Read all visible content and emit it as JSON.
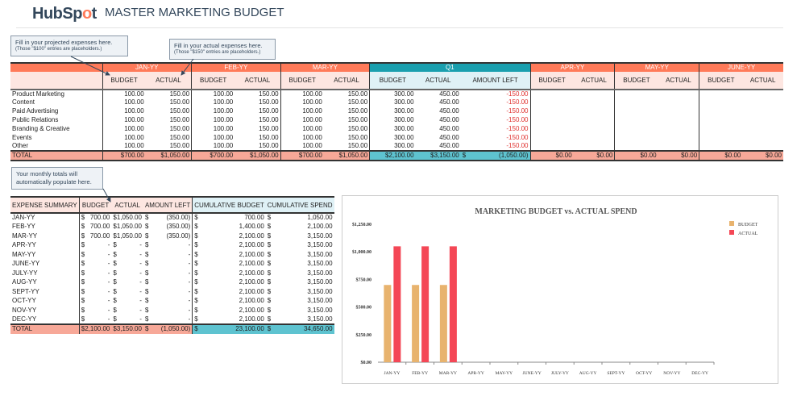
{
  "header": {
    "logo": "HubSpot",
    "title": "MASTER MARKETING BUDGET"
  },
  "callouts": {
    "projected": {
      "main": "Fill in your projected expenses here.",
      "note": "(Those \"$100\" entries are placeholders.)"
    },
    "actual": {
      "main": "Fill in your actual expenses here.",
      "note": "(Those \"$150\" entries are placeholders.)"
    },
    "monthly": {
      "main": "Your monthly totals will automatically populate here."
    }
  },
  "top_table": {
    "months": [
      "JAN-YY",
      "FEB-YY",
      "MAR-YY"
    ],
    "quarter": "Q1",
    "later_months": [
      "APR-YY",
      "MAY-YY",
      "JUNE-YY"
    ],
    "sub": {
      "budget": "BUDGET",
      "actual": "ACTUAL",
      "left": "AMOUNT LEFT"
    },
    "rows": [
      {
        "label": "Product Marketing",
        "budget": "100.00",
        "actual": "150.00",
        "q_budget": "300.00",
        "q_actual": "450.00",
        "q_left": "-150.00"
      },
      {
        "label": "Content",
        "budget": "100.00",
        "actual": "150.00",
        "q_budget": "300.00",
        "q_actual": "450.00",
        "q_left": "-150.00"
      },
      {
        "label": "Paid Advertising",
        "budget": "100.00",
        "actual": "150.00",
        "q_budget": "300.00",
        "q_actual": "450.00",
        "q_left": "-150.00"
      },
      {
        "label": "Public Relations",
        "budget": "100.00",
        "actual": "150.00",
        "q_budget": "300.00",
        "q_actual": "450.00",
        "q_left": "-150.00"
      },
      {
        "label": "Branding & Creative",
        "budget": "100.00",
        "actual": "150.00",
        "q_budget": "300.00",
        "q_actual": "450.00",
        "q_left": "-150.00"
      },
      {
        "label": "Events",
        "budget": "100.00",
        "actual": "150.00",
        "q_budget": "300.00",
        "q_actual": "450.00",
        "q_left": "-150.00"
      },
      {
        "label": "Other",
        "budget": "100.00",
        "actual": "150.00",
        "q_budget": "300.00",
        "q_actual": "450.00",
        "q_left": "-150.00"
      }
    ],
    "total": {
      "label": "TOTAL",
      "budget": "$700.00",
      "actual": "$1,050.00",
      "q_budget": "$2,100.00",
      "q_actual": "$3,150.00",
      "q_left_sym": "$",
      "q_left": "(1,050.00)",
      "empty": "$0.00"
    }
  },
  "summary": {
    "headers": [
      "EXPENSE SUMMARY",
      "BUDGET",
      "ACTUAL",
      "AMOUNT LEFT",
      "CUMULATIVE BUDGET",
      "CUMULATIVE SPEND"
    ],
    "cur": "$",
    "rows": [
      [
        "JAN-YY",
        "700.00",
        "1,050.00",
        "(350.00)",
        "700.00",
        "1,050.00"
      ],
      [
        "FEB-YY",
        "700.00",
        "1,050.00",
        "(350.00)",
        "1,400.00",
        "2,100.00"
      ],
      [
        "MAR-YY",
        "700.00",
        "1,050.00",
        "(350.00)",
        "2,100.00",
        "3,150.00"
      ],
      [
        "APR-YY",
        "-",
        "-",
        "-",
        "2,100.00",
        "3,150.00"
      ],
      [
        "MAY-YY",
        "-",
        "-",
        "-",
        "2,100.00",
        "3,150.00"
      ],
      [
        "JUNE-YY",
        "-",
        "-",
        "-",
        "2,100.00",
        "3,150.00"
      ],
      [
        "JULY-YY",
        "-",
        "-",
        "-",
        "2,100.00",
        "3,150.00"
      ],
      [
        "AUG-YY",
        "-",
        "-",
        "-",
        "2,100.00",
        "3,150.00"
      ],
      [
        "SEPT-YY",
        "-",
        "-",
        "-",
        "2,100.00",
        "3,150.00"
      ],
      [
        "OCT-YY",
        "-",
        "-",
        "-",
        "2,100.00",
        "3,150.00"
      ],
      [
        "NOV-YY",
        "-",
        "-",
        "-",
        "2,100.00",
        "3,150.00"
      ],
      [
        "DEC-YY",
        "-",
        "-",
        "-",
        "2,100.00",
        "3,150.00"
      ]
    ],
    "total": [
      "TOTAL",
      "2,100.00",
      "3,150.00",
      "(1,050.00)",
      "23,100.00",
      "34,650.00"
    ]
  },
  "colors": {
    "budget": "#e8b36e",
    "actual": "#f44756",
    "month": "#ff7a59",
    "quarter": "#1a9fae"
  },
  "chart_data": {
    "type": "bar",
    "title": "MARKETING BUDGET vs. ACTUAL SPEND",
    "categories": [
      "JAN-YY",
      "FEB-YY",
      "MAR-YY",
      "APR-YY",
      "MAY-YY",
      "JUNE-YY",
      "JULY-YY",
      "AUG-YY",
      "SEPT-YY",
      "OCT-YY",
      "NOV-YY",
      "DEC-YY"
    ],
    "series": [
      {
        "name": "BUDGET",
        "values": [
          700,
          700,
          700,
          0,
          0,
          0,
          0,
          0,
          0,
          0,
          0,
          0
        ]
      },
      {
        "name": "ACTUAL",
        "values": [
          1050,
          1050,
          1050,
          0,
          0,
          0,
          0,
          0,
          0,
          0,
          0,
          0
        ]
      }
    ],
    "yticks": [
      "$0.00",
      "$250.00",
      "$500.00",
      "$750.00",
      "$1,000.00",
      "$1,250.00"
    ],
    "ylim": [
      0,
      1250
    ],
    "legend": "right",
    "xlabel": "",
    "ylabel": ""
  }
}
